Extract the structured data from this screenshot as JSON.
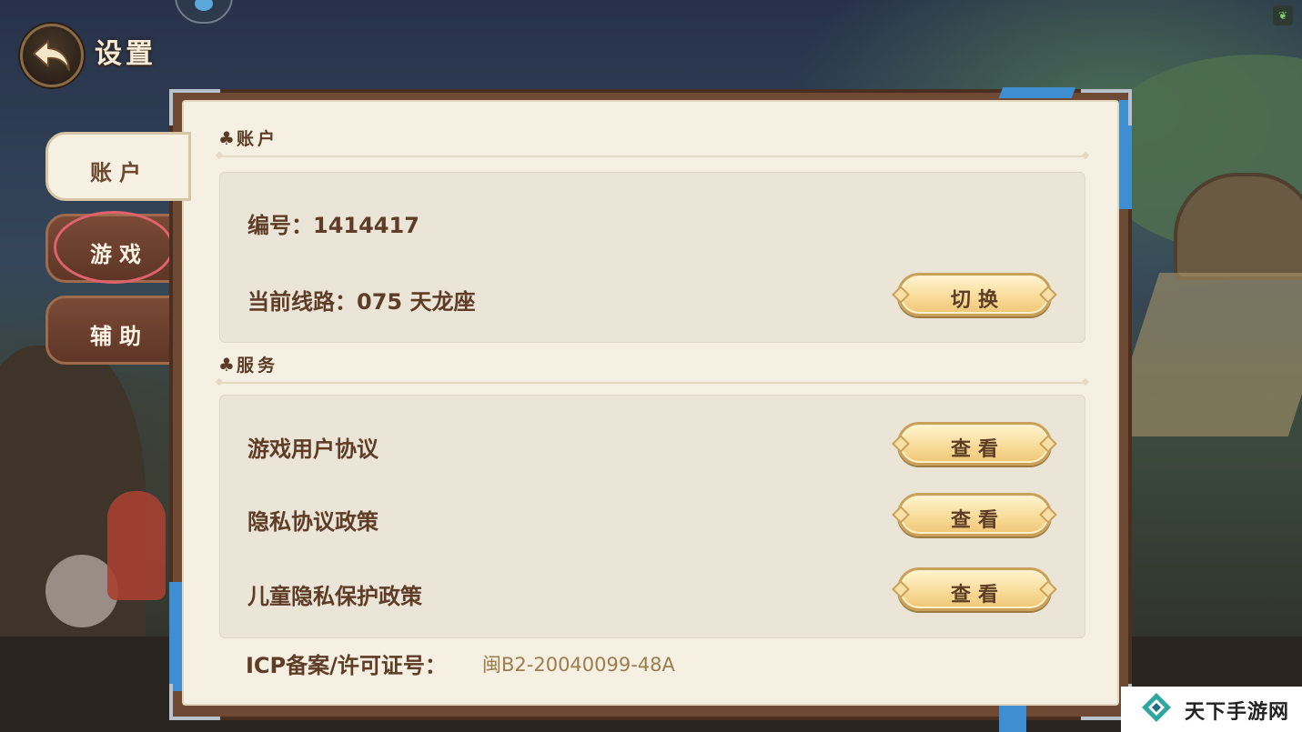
{
  "header": {
    "title": "设置"
  },
  "tabs": [
    {
      "label": "账户",
      "selected": true
    },
    {
      "label": "游戏",
      "selected": false,
      "highlighted": true
    },
    {
      "label": "辅助",
      "selected": false
    }
  ],
  "account_section": {
    "title": "账户",
    "id_label": "编号：1414417",
    "server_label": "当前线路：075 天龙座",
    "switch_button": "切换"
  },
  "service_section": {
    "title": "服务",
    "items": [
      {
        "label": "游戏用户协议",
        "button": "查看"
      },
      {
        "label": "隐私协议政策",
        "button": "查看"
      },
      {
        "label": "儿童隐私保护政策",
        "button": "查看"
      }
    ]
  },
  "icp": {
    "label": "ICP备案/许可证号：",
    "value": "闽B2-20040099-48A"
  },
  "watermark": {
    "text": "天下手游网"
  },
  "colors": {
    "accent_gold": "#f8dc9a",
    "tab_active": "#f7f1e3",
    "tab_inactive": "#6b3e2d",
    "highlight_ring": "#e0626c",
    "ribbon": "#3e8fd2"
  },
  "icons": {
    "back": "back-arrow-icon",
    "section": "club-icon",
    "corner": "leaf-icon",
    "watermark_logo": "diamond-logo-icon"
  }
}
